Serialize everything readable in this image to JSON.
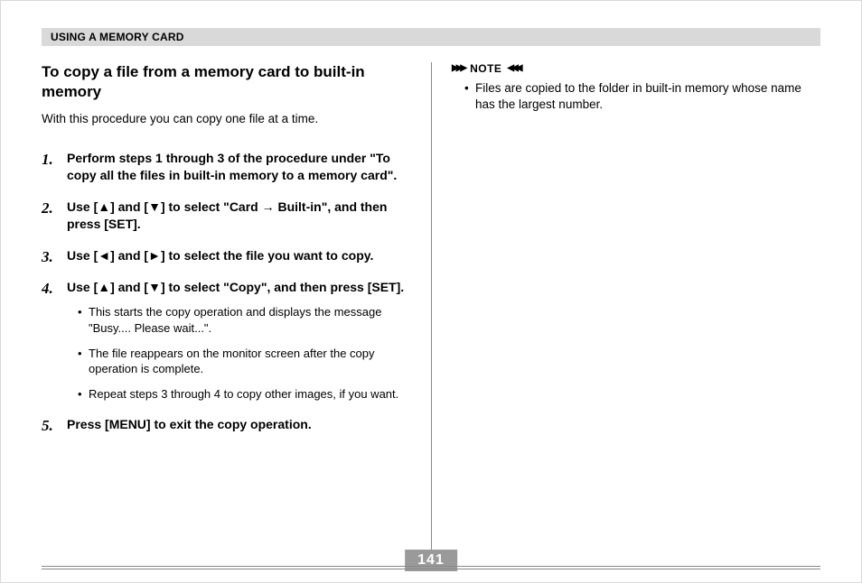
{
  "header": "USING A MEMORY CARD",
  "left": {
    "title": "To copy a file from a memory card to built-in memory",
    "intro": "With this procedure you can copy one file at a time.",
    "steps": {
      "s1": "Perform steps 1 through 3 of the procedure under \"To copy all the files in built-in memory to a memory card\".",
      "s2": "Use [▲] and [▼] to select \"Card → Built-in\", and then press [SET].",
      "s3": "Use [◄] and [►] to select the file you want to copy.",
      "s4": "Use [▲] and [▼] to select \"Copy\", and then press [SET].",
      "s4_sub1": "This starts the copy operation and displays the message \"Busy.... Please wait...\".",
      "s4_sub2": "The file reappears on the monitor screen after the copy operation is complete.",
      "s4_sub3": "Repeat steps 3 through 4 to copy other images, if you want.",
      "s5": "Press [MENU] to exit the copy operation."
    }
  },
  "right": {
    "note_label": "NOTE",
    "note_item": "Files are copied to the folder in built-in memory whose name has the largest number."
  },
  "page_number": "141"
}
